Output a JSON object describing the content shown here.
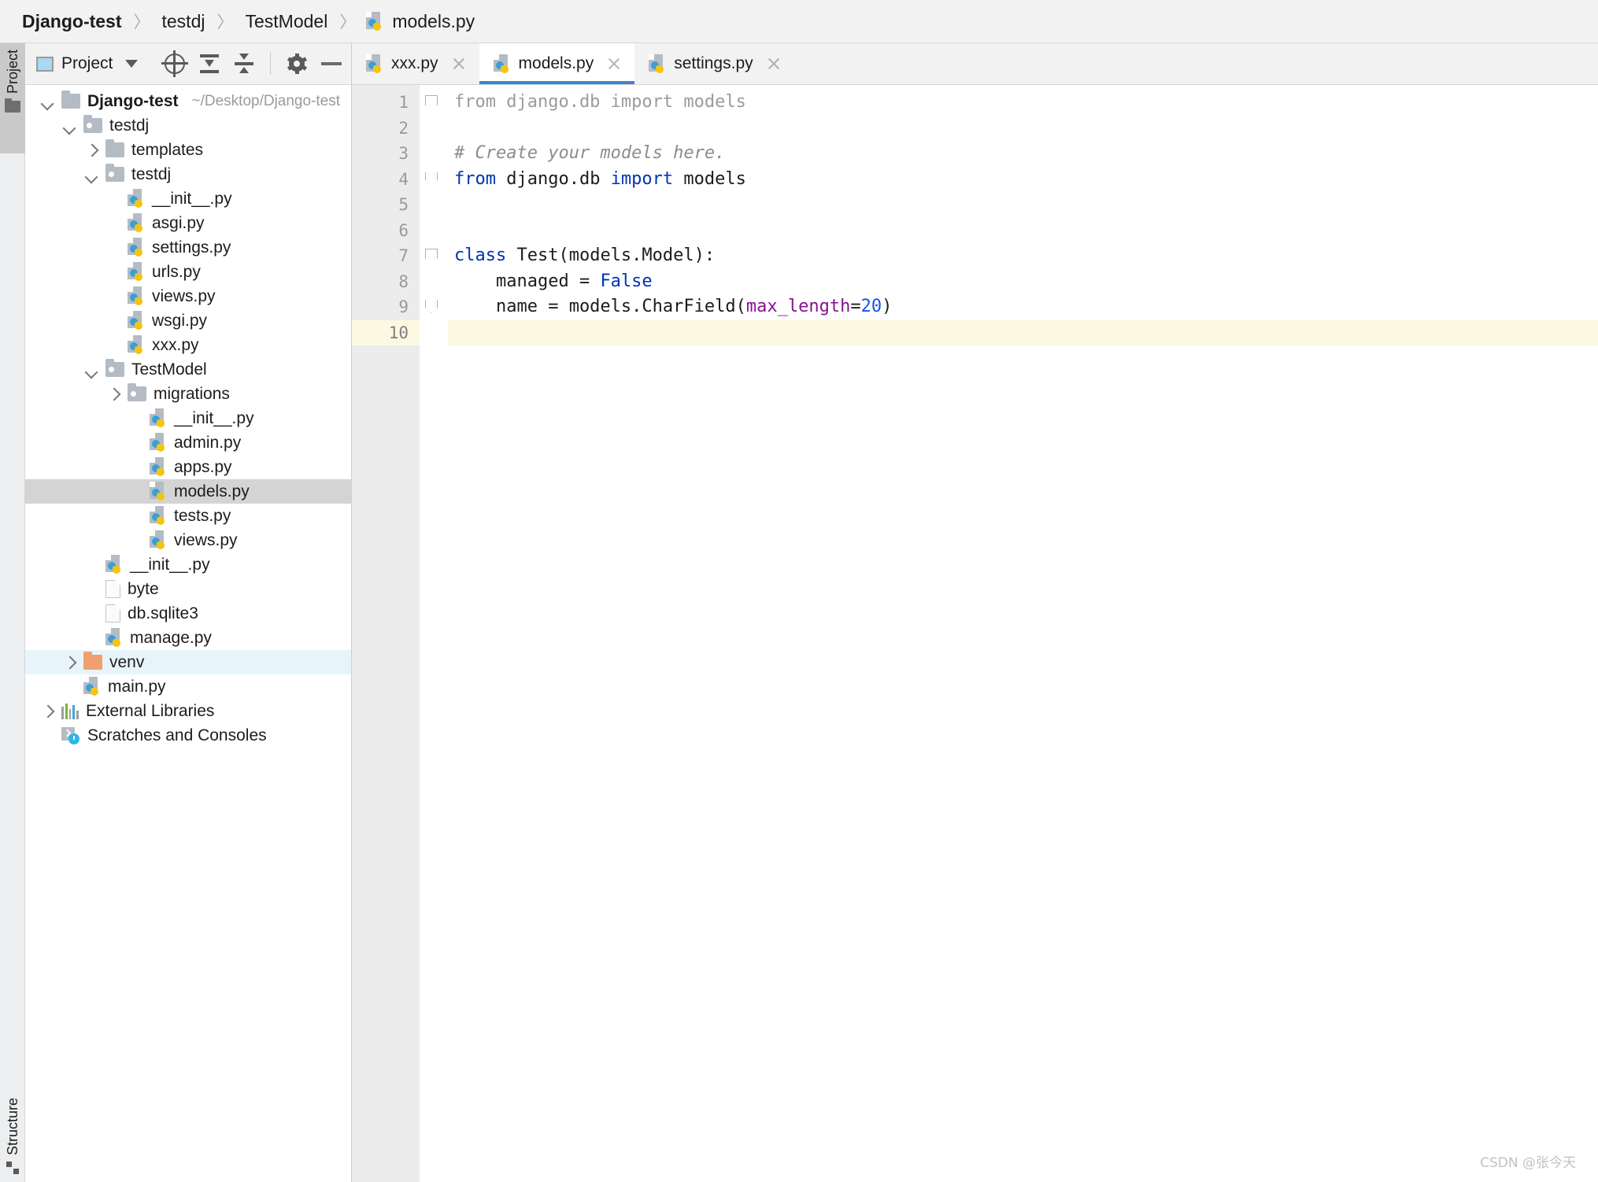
{
  "breadcrumb": {
    "items": [
      {
        "label": "Django-test",
        "bold": true,
        "icon": null
      },
      {
        "label": "testdj",
        "bold": false,
        "icon": null
      },
      {
        "label": "TestModel",
        "bold": false,
        "icon": null
      },
      {
        "label": "models.py",
        "bold": false,
        "icon": "python-file-icon"
      }
    ],
    "separator": "〉"
  },
  "tool_strip": {
    "project_tab_label": "Project",
    "structure_tab_label": "Structure"
  },
  "project_panel": {
    "title": "Project",
    "buttons": [
      {
        "name": "select-opened-file-button",
        "icon": "target-icon"
      },
      {
        "name": "expand-all-button",
        "icon": "expand-all-icon"
      },
      {
        "name": "collapse-all-button",
        "icon": "collapse-all-icon"
      },
      {
        "name": "settings-button",
        "icon": "gear-icon"
      },
      {
        "name": "hide-button",
        "icon": "minus-icon"
      }
    ],
    "tree": [
      {
        "label": "Django-test",
        "path": "~/Desktop/Django-test",
        "indent": 0,
        "arrow": "down",
        "icon": "folder",
        "bold": true,
        "state": "normal"
      },
      {
        "label": "testdj",
        "path": "",
        "indent": 1,
        "arrow": "down",
        "icon": "folder-module",
        "bold": false,
        "state": "normal"
      },
      {
        "label": "templates",
        "path": "",
        "indent": 2,
        "arrow": "right",
        "icon": "folder",
        "bold": false,
        "state": "normal"
      },
      {
        "label": "testdj",
        "path": "",
        "indent": 2,
        "arrow": "down",
        "icon": "folder-module",
        "bold": false,
        "state": "normal"
      },
      {
        "label": "__init__.py",
        "path": "",
        "indent": 3,
        "arrow": "none",
        "icon": "python",
        "bold": false,
        "state": "normal"
      },
      {
        "label": "asgi.py",
        "path": "",
        "indent": 3,
        "arrow": "none",
        "icon": "python",
        "bold": false,
        "state": "normal"
      },
      {
        "label": "settings.py",
        "path": "",
        "indent": 3,
        "arrow": "none",
        "icon": "python",
        "bold": false,
        "state": "normal"
      },
      {
        "label": "urls.py",
        "path": "",
        "indent": 3,
        "arrow": "none",
        "icon": "python",
        "bold": false,
        "state": "normal"
      },
      {
        "label": "views.py",
        "path": "",
        "indent": 3,
        "arrow": "none",
        "icon": "python",
        "bold": false,
        "state": "normal"
      },
      {
        "label": "wsgi.py",
        "path": "",
        "indent": 3,
        "arrow": "none",
        "icon": "python",
        "bold": false,
        "state": "normal"
      },
      {
        "label": "xxx.py",
        "path": "",
        "indent": 3,
        "arrow": "none",
        "icon": "python",
        "bold": false,
        "state": "normal"
      },
      {
        "label": "TestModel",
        "path": "",
        "indent": 2,
        "arrow": "down",
        "icon": "folder-module",
        "bold": false,
        "state": "normal"
      },
      {
        "label": "migrations",
        "path": "",
        "indent": 3,
        "arrow": "right",
        "icon": "folder-module",
        "bold": false,
        "state": "normal"
      },
      {
        "label": "__init__.py",
        "path": "",
        "indent": 4,
        "arrow": "none",
        "icon": "python",
        "bold": false,
        "state": "normal"
      },
      {
        "label": "admin.py",
        "path": "",
        "indent": 4,
        "arrow": "none",
        "icon": "python",
        "bold": false,
        "state": "normal"
      },
      {
        "label": "apps.py",
        "path": "",
        "indent": 4,
        "arrow": "none",
        "icon": "python",
        "bold": false,
        "state": "normal"
      },
      {
        "label": "models.py",
        "path": "",
        "indent": 4,
        "arrow": "none",
        "icon": "python",
        "bold": false,
        "state": "selected"
      },
      {
        "label": "tests.py",
        "path": "",
        "indent": 4,
        "arrow": "none",
        "icon": "python",
        "bold": false,
        "state": "normal"
      },
      {
        "label": "views.py",
        "path": "",
        "indent": 4,
        "arrow": "none",
        "icon": "python",
        "bold": false,
        "state": "normal"
      },
      {
        "label": "__init__.py",
        "path": "",
        "indent": 2,
        "arrow": "none",
        "icon": "python",
        "bold": false,
        "state": "normal"
      },
      {
        "label": "byte",
        "path": "",
        "indent": 2,
        "arrow": "none",
        "icon": "file",
        "bold": false,
        "state": "normal"
      },
      {
        "label": "db.sqlite3",
        "path": "",
        "indent": 2,
        "arrow": "none",
        "icon": "file",
        "bold": false,
        "state": "normal"
      },
      {
        "label": "manage.py",
        "path": "",
        "indent": 2,
        "arrow": "none",
        "icon": "python",
        "bold": false,
        "state": "normal"
      },
      {
        "label": "venv",
        "path": "",
        "indent": 1,
        "arrow": "right",
        "icon": "folder-orange",
        "bold": false,
        "state": "focused"
      },
      {
        "label": "main.py",
        "path": "",
        "indent": 1,
        "arrow": "none",
        "icon": "python",
        "bold": false,
        "state": "normal"
      },
      {
        "label": "External Libraries",
        "path": "",
        "indent": 0,
        "arrow": "right",
        "icon": "external-libraries",
        "bold": false,
        "state": "normal"
      },
      {
        "label": "Scratches and Consoles",
        "path": "",
        "indent": 0,
        "arrow": "none",
        "icon": "scratches",
        "bold": false,
        "state": "normal"
      }
    ]
  },
  "editor": {
    "tabs": [
      {
        "label": "xxx.py",
        "active": false,
        "icon": "python-file-icon",
        "closable": true
      },
      {
        "label": "models.py",
        "active": true,
        "icon": "python-file-icon",
        "closable": true
      },
      {
        "label": "settings.py",
        "active": false,
        "icon": "python-file-icon",
        "closable": true
      }
    ],
    "current_line": 10,
    "lines": [
      {
        "no": "1",
        "fold": "tip",
        "current": false,
        "tokens": [
          {
            "t": "from django.db import models",
            "c": "dim"
          }
        ]
      },
      {
        "no": "2",
        "fold": "none",
        "current": false,
        "tokens": []
      },
      {
        "no": "3",
        "fold": "none",
        "current": false,
        "tokens": [
          {
            "t": "# Create your models here.",
            "c": "comment"
          }
        ]
      },
      {
        "no": "4",
        "fold": "tipbottom",
        "current": false,
        "tokens": [
          {
            "t": "from",
            "c": "kw"
          },
          {
            "t": " django.db ",
            "c": "plain"
          },
          {
            "t": "import",
            "c": "kw"
          },
          {
            "t": " models",
            "c": "plain"
          }
        ]
      },
      {
        "no": "5",
        "fold": "none",
        "current": false,
        "tokens": []
      },
      {
        "no": "6",
        "fold": "none",
        "current": false,
        "tokens": []
      },
      {
        "no": "7",
        "fold": "tip",
        "current": false,
        "tokens": [
          {
            "t": "class",
            "c": "kw"
          },
          {
            "t": " Test(models.Model):",
            "c": "plain"
          }
        ]
      },
      {
        "no": "8",
        "fold": "none",
        "current": false,
        "tokens": [
          {
            "t": "    managed = ",
            "c": "plain"
          },
          {
            "t": "False",
            "c": "kw"
          }
        ]
      },
      {
        "no": "9",
        "fold": "tipbottom",
        "current": false,
        "tokens": [
          {
            "t": "    name = models.CharField(",
            "c": "plain"
          },
          {
            "t": "max_length",
            "c": "param"
          },
          {
            "t": "=",
            "c": "plain"
          },
          {
            "t": "20",
            "c": "num"
          },
          {
            "t": ")",
            "c": "plain"
          }
        ]
      },
      {
        "no": "10",
        "fold": "none",
        "current": true,
        "tokens": []
      }
    ]
  },
  "watermark": "CSDN @张今天",
  "colors": {
    "accent": "#4083c9",
    "selection": "#d4d4d4",
    "focus_row": "#e8f4fb",
    "current_line": "#fdf8e2",
    "keyword": "#0033b3",
    "param": "#871094",
    "number": "#1750eb",
    "comment": "#8c8c8c",
    "dim_code": "#9b9b9b"
  }
}
